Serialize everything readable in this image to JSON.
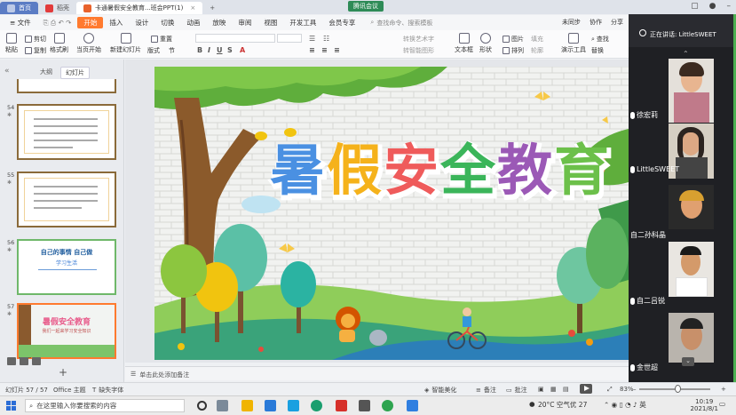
{
  "titlebar": {
    "tabs": [
      {
        "label": "首页",
        "kind": "home"
      },
      {
        "label": "稻壳",
        "kind": "normal"
      },
      {
        "label": "卡通暑假安全教育...班会PPT(1)",
        "kind": "active"
      }
    ],
    "meeting_badge": "腾讯会议"
  },
  "menubar": {
    "file": "文件",
    "items": [
      "开始",
      "插入",
      "设计",
      "切换",
      "动画",
      "放映",
      "审阅",
      "视图",
      "开发工具",
      "会员专享"
    ],
    "active": "开始",
    "search_placeholder": "查找命令、搜索模板",
    "right": [
      "未同步",
      "协作",
      "分享"
    ]
  },
  "ribbon": {
    "paste": "粘贴",
    "cut": "剪切",
    "copy": "复制",
    "format_painter": "格式刷",
    "from_current": "当页开始",
    "new_slide": "新建幻灯片",
    "layout": "版式",
    "section": "节",
    "reset": "重置",
    "textbox": "文本框",
    "shape": "形状",
    "arrange": "排列",
    "image": "图片",
    "fill": "填充",
    "outline": "轮廓",
    "present_tools": "演示工具",
    "find": "查找",
    "replace": "替换",
    "convert_art": "转换艺术字",
    "convert_smartart": "转智能图形"
  },
  "leftpanel": {
    "tabs": [
      "大纲",
      "幻灯片"
    ],
    "active_tab": "幻灯片",
    "slides": [
      {
        "num": "54",
        "title": ""
      },
      {
        "num": "55",
        "title": ""
      },
      {
        "num": "56",
        "title": "自己的事情 自己做",
        "sub": "学习生活"
      },
      {
        "num": "57",
        "title": "暑假安全教育",
        "sub": "我们一起来学习安全知识",
        "selected": true
      }
    ]
  },
  "slide": {
    "title": "暑假安全教育",
    "title_colors": [
      "#4a90e2",
      "#f5b21b",
      "#ef5b5b",
      "#3bb55a",
      "#9b59b6",
      "#6cc04a"
    ]
  },
  "notes": {
    "placeholder": "单击此处添加备注"
  },
  "statusbar": {
    "slide_count": "幻灯片 57 / 57",
    "theme": "Office 主题",
    "font_missing": "缺失字体",
    "beautify": "智能美化",
    "notes": "备注",
    "comments": "批注",
    "zoom": "83%"
  },
  "taskbar": {
    "search_placeholder": "在这里输入你要搜索的内容",
    "weather": "20°C 空气优 27",
    "time": "10:19",
    "date": "2021/8/1"
  },
  "meeting": {
    "speaking_label": "正在讲话: LittleSWEET",
    "participants": [
      {
        "name": "徐宏莉"
      },
      {
        "name": "LittleSWEET"
      },
      {
        "name": "自二孙科晶"
      },
      {
        "name": "自二吕锐"
      },
      {
        "name": "金世超"
      }
    ]
  }
}
